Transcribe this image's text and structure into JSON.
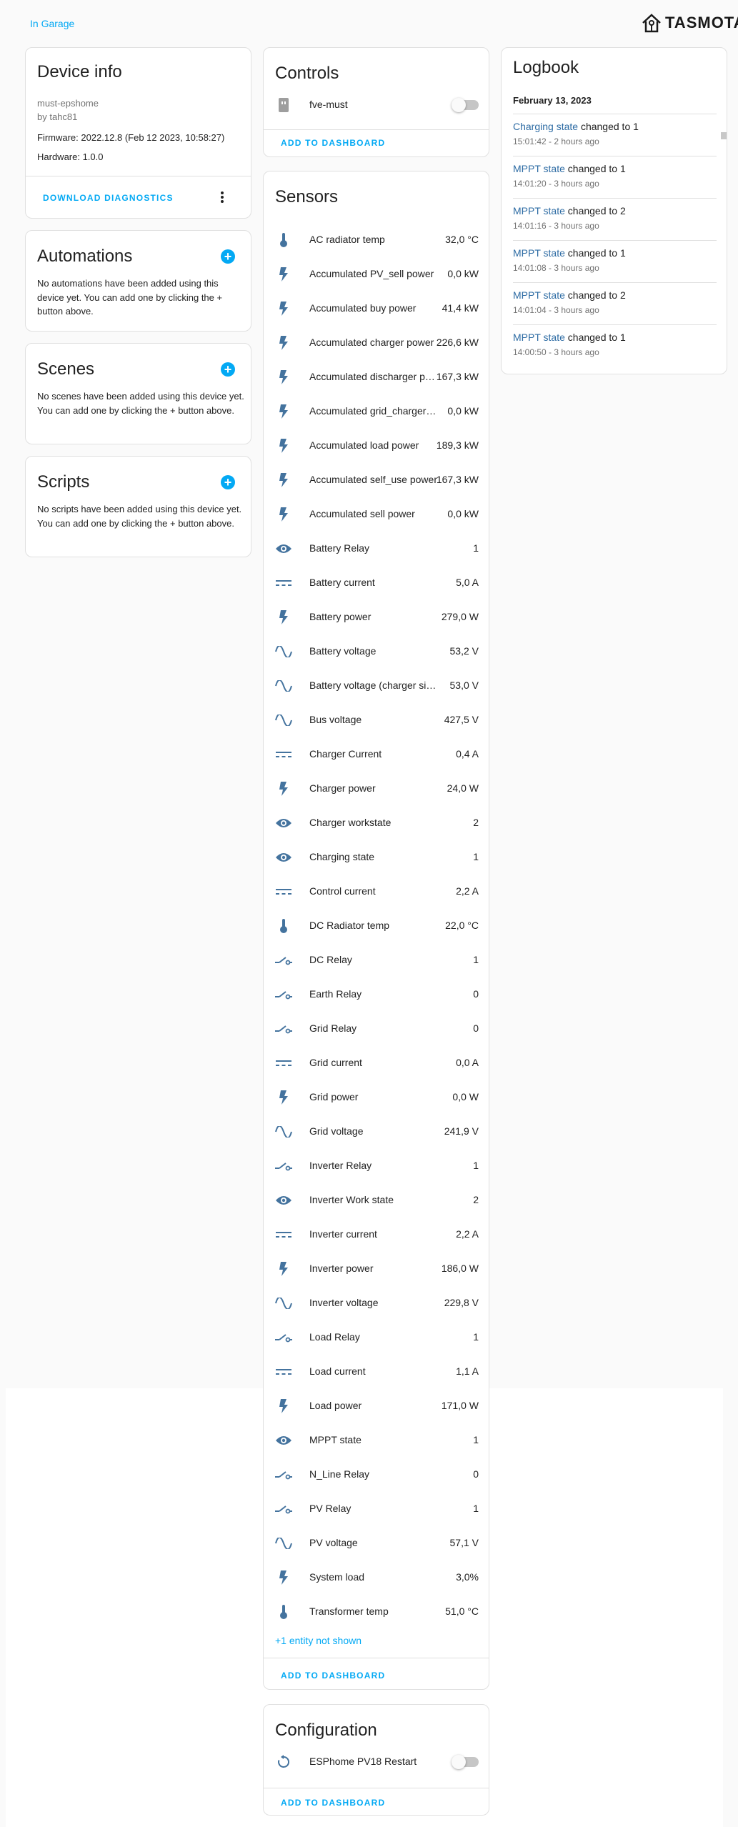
{
  "header": {
    "breadcrumb": "In Garage",
    "logo_text": "TASMOTA"
  },
  "device_info": {
    "title": "Device info",
    "name": "must-epshome",
    "by": "by tahc81",
    "firmware": "Firmware: 2022.12.8 (Feb 12 2023, 10:58:27)",
    "hardware": "Hardware: 1.0.0",
    "download_label": "DOWNLOAD DIAGNOSTICS"
  },
  "automations": {
    "title": "Automations",
    "description": "No automations have been added using this device yet. You can add one by clicking the + button above."
  },
  "scenes": {
    "title": "Scenes",
    "description": "No scenes have been added using this device yet. You can add one by clicking the + button above."
  },
  "scripts": {
    "title": "Scripts",
    "description": "No scripts have been added using this device yet. You can add one by clicking the + button above."
  },
  "controls": {
    "title": "Controls",
    "item": {
      "name": "fve-must",
      "icon": "power-socket-icon",
      "state": "off"
    },
    "add_label": "ADD TO DASHBOARD"
  },
  "sensors": {
    "title": "Sensors",
    "items": [
      {
        "name": "AC radiator temp",
        "value": "32,0 °C",
        "icon": "thermometer"
      },
      {
        "name": "Accumulated PV_sell power",
        "value": "0,0 kW",
        "icon": "flash"
      },
      {
        "name": "Accumulated buy power",
        "value": "41,4 kW",
        "icon": "flash"
      },
      {
        "name": "Accumulated charger power",
        "value": "226,6 kW",
        "icon": "flash"
      },
      {
        "name": "Accumulated discharger power",
        "value": "167,3 kW",
        "icon": "flash"
      },
      {
        "name": "Accumulated grid_charger power",
        "value": "0,0 kW",
        "icon": "flash"
      },
      {
        "name": "Accumulated load power",
        "value": "189,3 kW",
        "icon": "flash"
      },
      {
        "name": "Accumulated self_use power",
        "value": "167,3 kW",
        "icon": "flash"
      },
      {
        "name": "Accumulated sell power",
        "value": "0,0 kW",
        "icon": "flash"
      },
      {
        "name": "Battery Relay",
        "value": "1",
        "icon": "eye"
      },
      {
        "name": "Battery current",
        "value": "5,0 A",
        "icon": "current-dc"
      },
      {
        "name": "Battery power",
        "value": "279,0 W",
        "icon": "flash"
      },
      {
        "name": "Battery voltage",
        "value": "53,2 V",
        "icon": "sine-wave"
      },
      {
        "name": "Battery voltage (charger side)",
        "value": "53,0 V",
        "icon": "sine-wave"
      },
      {
        "name": "Bus voltage",
        "value": "427,5 V",
        "icon": "sine-wave"
      },
      {
        "name": "Charger Current",
        "value": "0,4 A",
        "icon": "current-dc"
      },
      {
        "name": "Charger power",
        "value": "24,0 W",
        "icon": "flash"
      },
      {
        "name": "Charger workstate",
        "value": "2",
        "icon": "eye"
      },
      {
        "name": "Charging state",
        "value": "1",
        "icon": "eye"
      },
      {
        "name": "Control current",
        "value": "2,2 A",
        "icon": "current-dc"
      },
      {
        "name": "DC Radiator temp",
        "value": "22,0 °C",
        "icon": "thermometer"
      },
      {
        "name": "DC Relay",
        "value": "1",
        "icon": "relay"
      },
      {
        "name": "Earth Relay",
        "value": "0",
        "icon": "relay"
      },
      {
        "name": "Grid Relay",
        "value": "0",
        "icon": "relay"
      },
      {
        "name": "Grid current",
        "value": "0,0 A",
        "icon": "current-dc"
      },
      {
        "name": "Grid power",
        "value": "0,0 W",
        "icon": "flash"
      },
      {
        "name": "Grid voltage",
        "value": "241,9 V",
        "icon": "sine-wave"
      },
      {
        "name": "Inverter Relay",
        "value": "1",
        "icon": "relay"
      },
      {
        "name": "Inverter Work state",
        "value": "2",
        "icon": "eye"
      },
      {
        "name": "Inverter current",
        "value": "2,2 A",
        "icon": "current-dc"
      },
      {
        "name": "Inverter power",
        "value": "186,0 W",
        "icon": "flash"
      },
      {
        "name": "Inverter voltage",
        "value": "229,8 V",
        "icon": "sine-wave"
      },
      {
        "name": "Load Relay",
        "value": "1",
        "icon": "relay"
      },
      {
        "name": "Load current",
        "value": "1,1 A",
        "icon": "current-dc"
      },
      {
        "name": "Load power",
        "value": "171,0 W",
        "icon": "flash"
      },
      {
        "name": "MPPT state",
        "value": "1",
        "icon": "eye"
      },
      {
        "name": "N_Line Relay",
        "value": "0",
        "icon": "relay"
      },
      {
        "name": "PV Relay",
        "value": "1",
        "icon": "relay"
      },
      {
        "name": "PV voltage",
        "value": "57,1 V",
        "icon": "sine-wave"
      },
      {
        "name": "System load",
        "value": "3,0%",
        "icon": "flash"
      },
      {
        "name": "Transformer temp",
        "value": "51,0 °C",
        "icon": "thermometer"
      }
    ],
    "more_label": "+1 entity not shown",
    "add_label": "ADD TO DASHBOARD"
  },
  "configuration": {
    "title": "Configuration",
    "item": {
      "name": "ESPhome PV18 Restart",
      "icon": "restart-icon",
      "state": "off"
    },
    "add_label": "ADD TO DASHBOARD"
  },
  "logbook": {
    "title": "Logbook",
    "date": "February 13, 2023",
    "entries": [
      {
        "entity": "Charging state",
        "text": " changed to 1",
        "time": "15:01:42 - 2 hours ago"
      },
      {
        "entity": "MPPT state",
        "text": " changed to 1",
        "time": "14:01:20 - 3 hours ago"
      },
      {
        "entity": "MPPT state",
        "text": " changed to 2",
        "time": "14:01:16 - 3 hours ago"
      },
      {
        "entity": "MPPT state",
        "text": " changed to 1",
        "time": "14:01:08 - 3 hours ago"
      },
      {
        "entity": "MPPT state",
        "text": " changed to 2",
        "time": "14:01:04 - 3 hours ago"
      },
      {
        "entity": "MPPT state",
        "text": " changed to 1",
        "time": "14:00:50 - 3 hours ago"
      }
    ]
  },
  "colors": {
    "accent": "#03a9f4",
    "icon": "#44739e",
    "link": "#2e6ca4"
  }
}
